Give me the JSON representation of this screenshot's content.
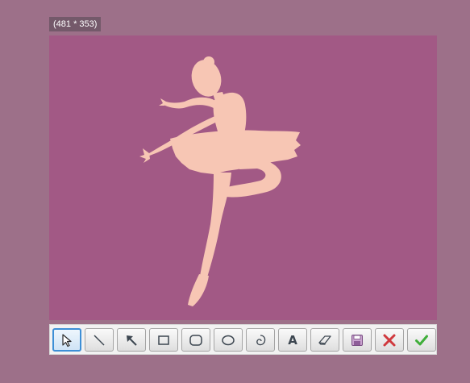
{
  "selection": {
    "size_label": "(481 * 353)",
    "background_color": "#a25985",
    "figure_color": "#f7c6b4",
    "figure": "dancer-silhouette"
  },
  "toolbar": {
    "active_tool": "select",
    "tools": [
      {
        "id": "select",
        "icon": "cursor-icon",
        "active": true
      },
      {
        "id": "line",
        "icon": "line-icon",
        "active": false
      },
      {
        "id": "arrow",
        "icon": "arrow-icon",
        "active": false
      },
      {
        "id": "rectangle",
        "icon": "rectangle-icon",
        "active": false
      },
      {
        "id": "rounded-rectangle",
        "icon": "rounded-rectangle-icon",
        "active": false
      },
      {
        "id": "ellipse",
        "icon": "ellipse-icon",
        "active": false
      },
      {
        "id": "freehand",
        "icon": "freehand-icon",
        "active": false
      },
      {
        "id": "text",
        "icon": "text-icon",
        "label": "A",
        "active": false
      },
      {
        "id": "eraser",
        "icon": "eraser-icon",
        "active": false
      },
      {
        "id": "save",
        "icon": "save-icon",
        "active": false
      },
      {
        "id": "cancel",
        "icon": "close-icon",
        "active": false
      },
      {
        "id": "confirm",
        "icon": "checkmark-icon",
        "active": false
      }
    ]
  },
  "colors": {
    "backdrop": "#9d7089",
    "active_border": "#3d8fd6",
    "cancel": "#d0393e",
    "confirm": "#3fae3a"
  }
}
